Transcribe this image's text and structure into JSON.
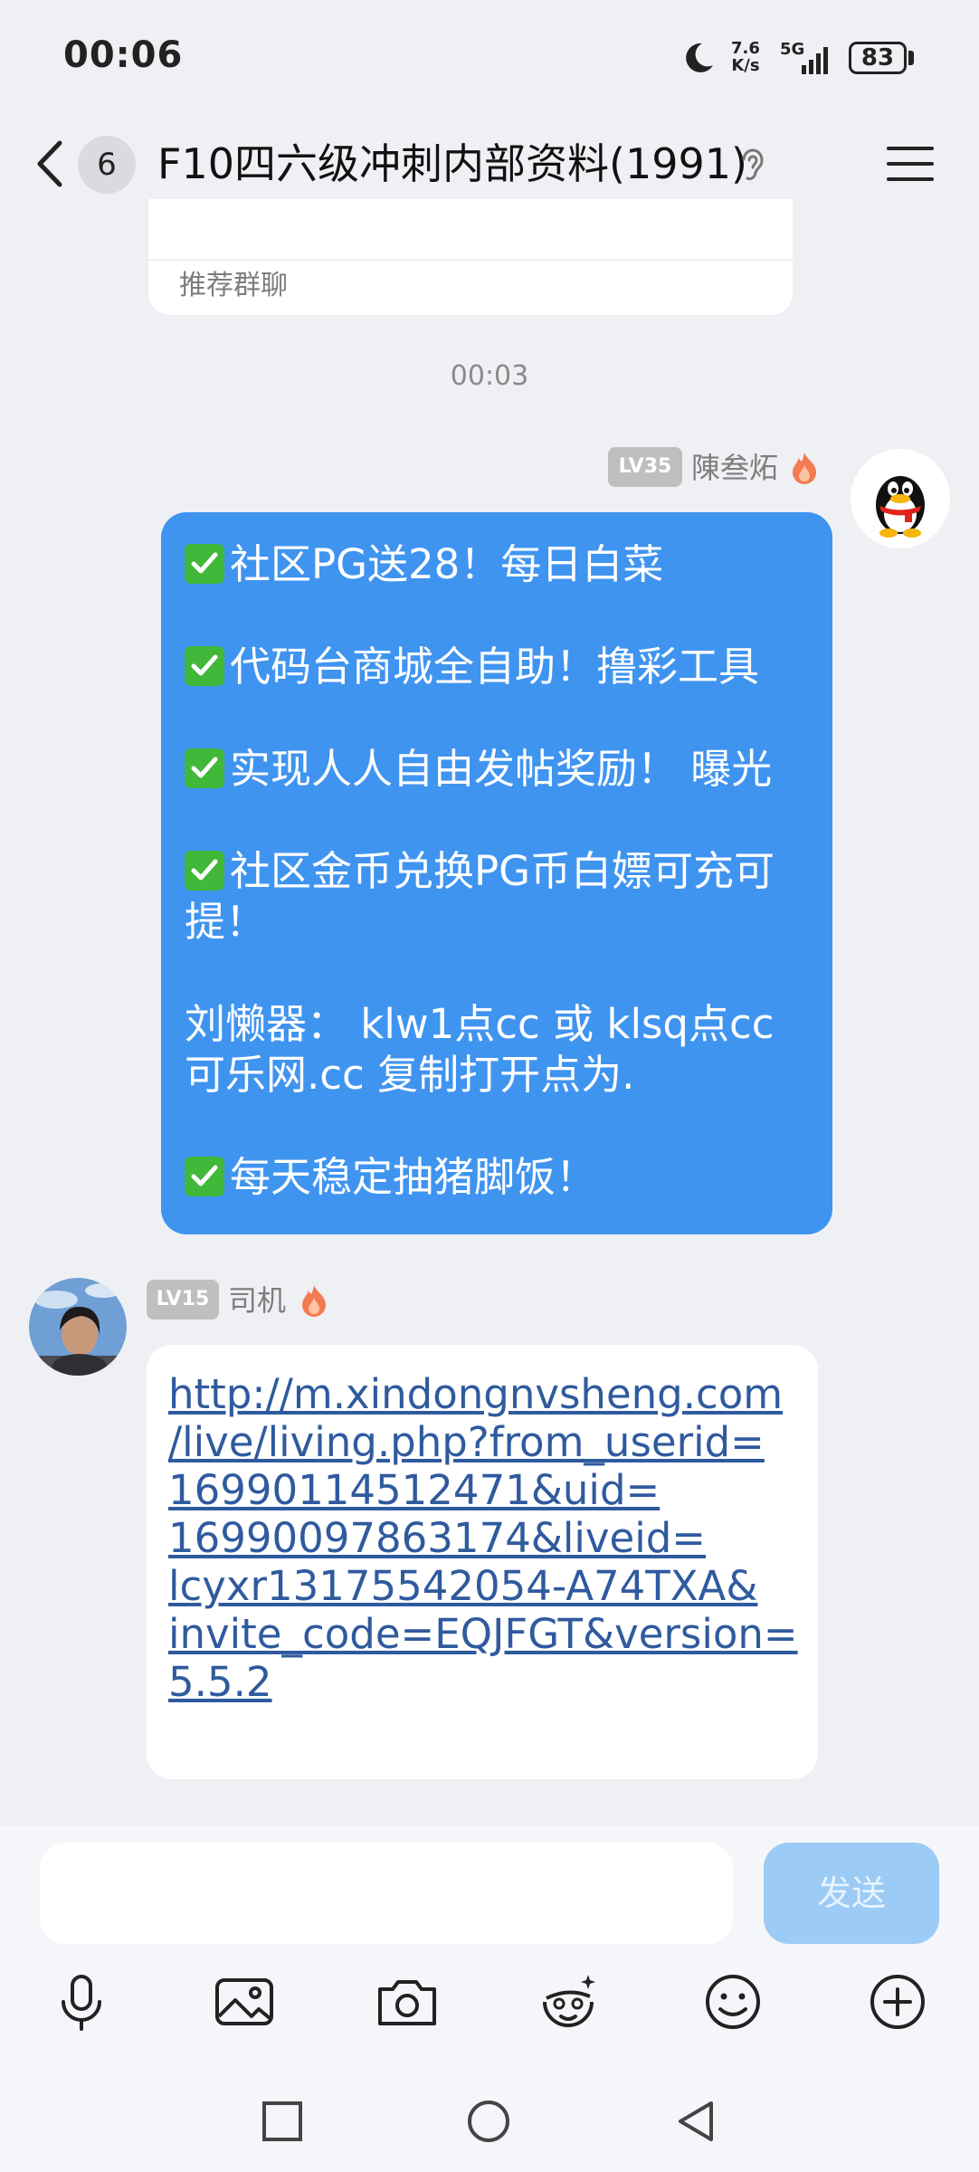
{
  "status_bar": {
    "time": "00:06",
    "net_speed_top": "7.6",
    "net_speed_bottom": "K/s",
    "network": "5G",
    "battery": "83"
  },
  "header": {
    "unread_count": "6",
    "title": "F10四六级冲刺内部资料(1991)"
  },
  "recommend_card": {
    "label": "推荐群聊"
  },
  "time_divider": "00:03",
  "messages": [
    {
      "side": "right",
      "level": "LV35",
      "sender": "陳叁炻",
      "bubble_color": "#3f94f0",
      "lines": [
        "社区PG送28！每日白菜",
        "代码台商城全自助！撸彩工具",
        "实现人人自由发帖奖励！ 曝光",
        "社区金币兑换PG币白嫖可充可",
        "提！",
        "刘懒器： klw1点cc 或 klsq点cc",
        "可乐网.cc  复制打开点为.",
        "每天稳定抽猪脚饭！"
      ]
    },
    {
      "side": "left",
      "level": "LV15",
      "sender": "司机",
      "link_lines": [
        "http://m.xindongnvsheng.com",
        "/live/living.php?from_userid=",
        "16990114512471&uid=",
        "16990097863174&liveid=",
        "lcyxr13175542054-A74TXA&",
        "invite_code=EQJFGT&version=",
        "5.5.2"
      ]
    }
  ],
  "composer": {
    "send_label": "发送",
    "input_value": ""
  },
  "toolbar_icons": [
    "microphone-icon",
    "image-icon",
    "camera-icon",
    "sticker-icon",
    "emoji-icon",
    "plus-icon"
  ],
  "colors": {
    "accent": "#3f94f0",
    "send_button": "#9ccbf6",
    "link": "#2f5a9e",
    "background": "#eff0f4"
  }
}
